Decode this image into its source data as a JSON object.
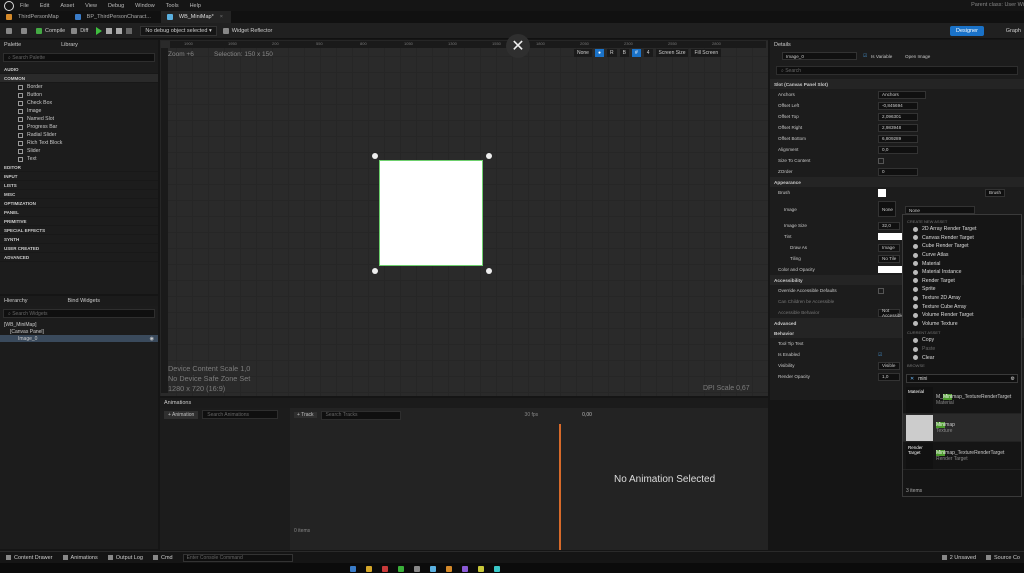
{
  "menu": [
    "File",
    "Edit",
    "Asset",
    "View",
    "Debug",
    "Window",
    "Tools",
    "Help"
  ],
  "parent_class": "Parent class: User Wi",
  "tabs": [
    {
      "label": "ThirdPersonMap"
    },
    {
      "label": "BP_ThirdPersonCharact..."
    },
    {
      "label": "WB_MiniMap*"
    }
  ],
  "toolbar": {
    "compile": "Compile",
    "diff": "Diff",
    "debug_object": "No debug object selected",
    "reflector": "Widget Reflector",
    "designer": "Designer",
    "graph": "Graph"
  },
  "palette": {
    "title": "Palette",
    "library": "Library",
    "search_placeholder": "Search Palette",
    "categories_top": [
      "AUDIO",
      "COMMON"
    ],
    "common_items": [
      "Border",
      "Button",
      "Check Box",
      "Image",
      "Named Slot",
      "Progress Bar",
      "Radial Slider",
      "Rich Text Block",
      "Slider",
      "Text"
    ],
    "categories_rest": [
      "EDITOR",
      "INPUT",
      "LISTS",
      "MISC",
      "OPTIMIZATION",
      "PANEL",
      "PRIMITIVE",
      "SPECIAL EFFECTS",
      "SYNTH",
      "USER CREATED",
      "ADVANCED"
    ]
  },
  "hierarchy": {
    "title": "Hierarchy",
    "bind": "Bind Widgets",
    "search_placeholder": "Search Widgets",
    "rows": [
      "[WB_MiniMap]",
      "[Canvas Panel]",
      "Image_0"
    ]
  },
  "canvas": {
    "zoom": "Zoom +6",
    "selection": "Selection: 150 x 150",
    "overlay": [
      "Device Content Scale 1,0",
      "No Device Safe Zone Set",
      "1280 x 720 (16:9)"
    ],
    "dpi": "DPI Scale 0,67",
    "screen_size": "Screen Size",
    "fill_screen": "Fill Screen",
    "none": "None",
    "grid_num": "4",
    "ruler": [
      "1900",
      "1950",
      "200",
      "550",
      "800",
      "1050",
      "1300",
      "1550",
      "1800",
      "2050",
      "2300",
      "2550",
      "2800"
    ]
  },
  "details": {
    "title": "Details",
    "name": "Image_0",
    "is_variable": "Is Variable",
    "open_image": "Open Image",
    "search_placeholder": "Search",
    "slot_section": "Slot (Canvas Panel Slot)",
    "rows": [
      {
        "label": "Anchors",
        "value": "Anchors"
      },
      {
        "label": "Offset Left",
        "value": "-0,845694"
      },
      {
        "label": "Offset Top",
        "value": "2,096301"
      },
      {
        "label": "Offset Right",
        "value": "2,983948"
      },
      {
        "label": "Offset Bottom",
        "value": "6,809289"
      },
      {
        "label": "Alignment",
        "value": "0,0"
      },
      {
        "label": "Size To Content",
        "value": ""
      },
      {
        "label": "ZOrder",
        "value": "0"
      }
    ],
    "appearance": "Appearance",
    "brush": "Brush",
    "image": "Image",
    "image_none": "None",
    "image_size": "Image Size",
    "image_size_val": "32,0",
    "tint": "Tint",
    "draw_as": "Draw As",
    "draw_as_val": "Image",
    "tiling": "Tiling",
    "tiling_val": "No Tile",
    "color_opacity": "Color and Opacity",
    "accessibility": "Accessibility",
    "override_acc": "Override Accessible Defaults",
    "can_children": "Can Children be Accessible",
    "acc_behavior": "Accessible Behavior",
    "acc_val": "Not Accessible",
    "advanced": "Advanced",
    "behavior": "Behavior",
    "tooltip": "Tool Tip Text",
    "is_enabled": "Is Enabled",
    "visibility": "Visibility",
    "visibility_val": "Visible",
    "render_opacity": "Render Opacity",
    "render_opacity_val": "1,0",
    "brush_mode": "Brush"
  },
  "dropdown": {
    "create_header": "CREATE NEW ASSET",
    "create_items": [
      "2D Array Render Target",
      "Canvas Render Target",
      "Cube Render Target",
      "Curve Atlas",
      "Material",
      "Material Instance",
      "Render Target",
      "Sprite",
      "Texture 2D Array",
      "Texture Cube Array",
      "Volume Render Target",
      "Volume Texture"
    ],
    "current_header": "CURRENT ASSET",
    "current_items": [
      "Copy",
      "Paste",
      "Clear"
    ],
    "browse_header": "BROWSE",
    "filter": "mini",
    "assets": [
      {
        "thumb": "Material",
        "pre": "M_",
        "hl": "Mini",
        "post": "map_TextureRenderTarget",
        "type": "Material"
      },
      {
        "thumb": "",
        "pre": "",
        "hl": "Mini",
        "post": "map",
        "type": "Texture"
      },
      {
        "thumb": "Render Target",
        "pre": "",
        "hl": "Mini",
        "post": "map_TextureRenderTarget",
        "type": "Render Target"
      }
    ],
    "count": "3 items"
  },
  "animations": {
    "title": "Animations",
    "add": "+ Animation",
    "search_placeholder": "Search Animations",
    "fps": "30 fps",
    "track": "+ Track",
    "search_tracks": "Search Tracks",
    "time": "0,00",
    "no_anim": "No Animation Selected",
    "items": "0 items"
  },
  "bottom": {
    "content_drawer": "Content Drawer",
    "animations": "Animations",
    "output_log": "Output Log",
    "cmd": "Cmd",
    "console_placeholder": "Enter Console Command",
    "unsaved": "2 Unsaved",
    "source": "Source Co"
  }
}
